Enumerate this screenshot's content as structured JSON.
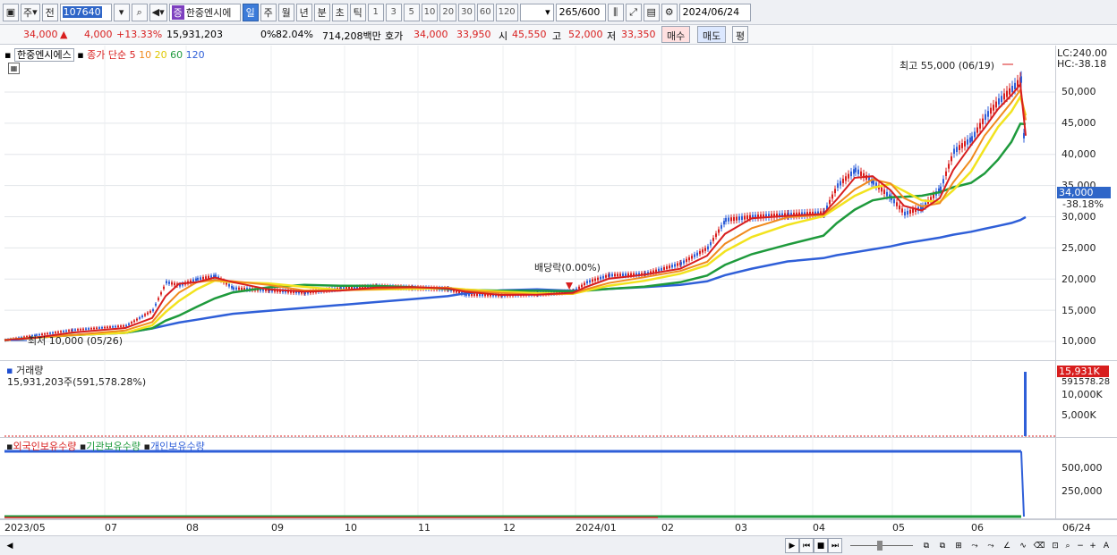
{
  "toolbar": {
    "period_main": "주",
    "prev_label": "전",
    "stock_code": "107640",
    "stock_tag": "증",
    "stock_name": "한중엔시에",
    "intervals": [
      "일",
      "주",
      "월",
      "년",
      "분",
      "초",
      "틱"
    ],
    "selected_interval": "일",
    "numbers": [
      "1",
      "3",
      "5",
      "10",
      "20",
      "30",
      "60",
      "120"
    ],
    "count_value": "265",
    "count_max": "/600",
    "date_value": "2024/06/24"
  },
  "infobar": {
    "price": "34,000",
    "change": "4,000",
    "change_pct": "+13.33%",
    "volume": "15,931,203",
    "turnover_pct": "0%",
    "rate": "82.04%",
    "amount": "714,208백만",
    "quote_label": "호가",
    "ask": "34,000",
    "bid": "33,950",
    "open_label": "시",
    "open": "45,550",
    "high_label": "고",
    "high": "52,000",
    "low_label": "저",
    "low": "33,350",
    "buy_label": "매수",
    "sell_label": "매도",
    "avg_label": "평"
  },
  "price_panel": {
    "legend_name": "한중엔시에스",
    "legend_ma_label": "종가 단순",
    "ma_periods": [
      "5",
      "10",
      "20",
      "60",
      "120"
    ],
    "ma_colors": [
      "#d81e1e",
      "#f08a1e",
      "#f2e31e",
      "#1e9a3c",
      "#2f5fd8"
    ],
    "high_annotation": "최고 55,000 (06/19)",
    "low_annotation": "최저 10,000 (05/26)",
    "dividend_annotation": "배당락(0.00%)",
    "lc_label": "LC:240.00",
    "hc_label": "HC:-38.18",
    "current_tag": "34,000",
    "current_pct": "-38.18%",
    "y_ticks": [
      "50,000",
      "45,000",
      "40,000",
      "35,000",
      "30,000",
      "25,000",
      "20,000",
      "15,000",
      "10,000"
    ]
  },
  "volume_panel": {
    "title": "거래량",
    "value_text": "15,931,203주(591,578.28%)",
    "tag": "15,931K",
    "tag2": "591578.28",
    "y_ticks": [
      "10,000K",
      "5,000K"
    ]
  },
  "holdings_panel": {
    "legend": [
      "외국인보유수량",
      "기관보유수량",
      "개인보유수량"
    ],
    "legend_colors": [
      "#d81e1e",
      "#1e9a3c",
      "#2f5fd8"
    ],
    "y_ticks": [
      "500,000",
      "250,000"
    ]
  },
  "xaxis": {
    "labels": [
      "2023/05",
      "07",
      "08",
      "09",
      "10",
      "11",
      "12",
      "2024/01",
      "02",
      "03",
      "04",
      "05",
      "06"
    ],
    "right_label": "06/24"
  }
}
